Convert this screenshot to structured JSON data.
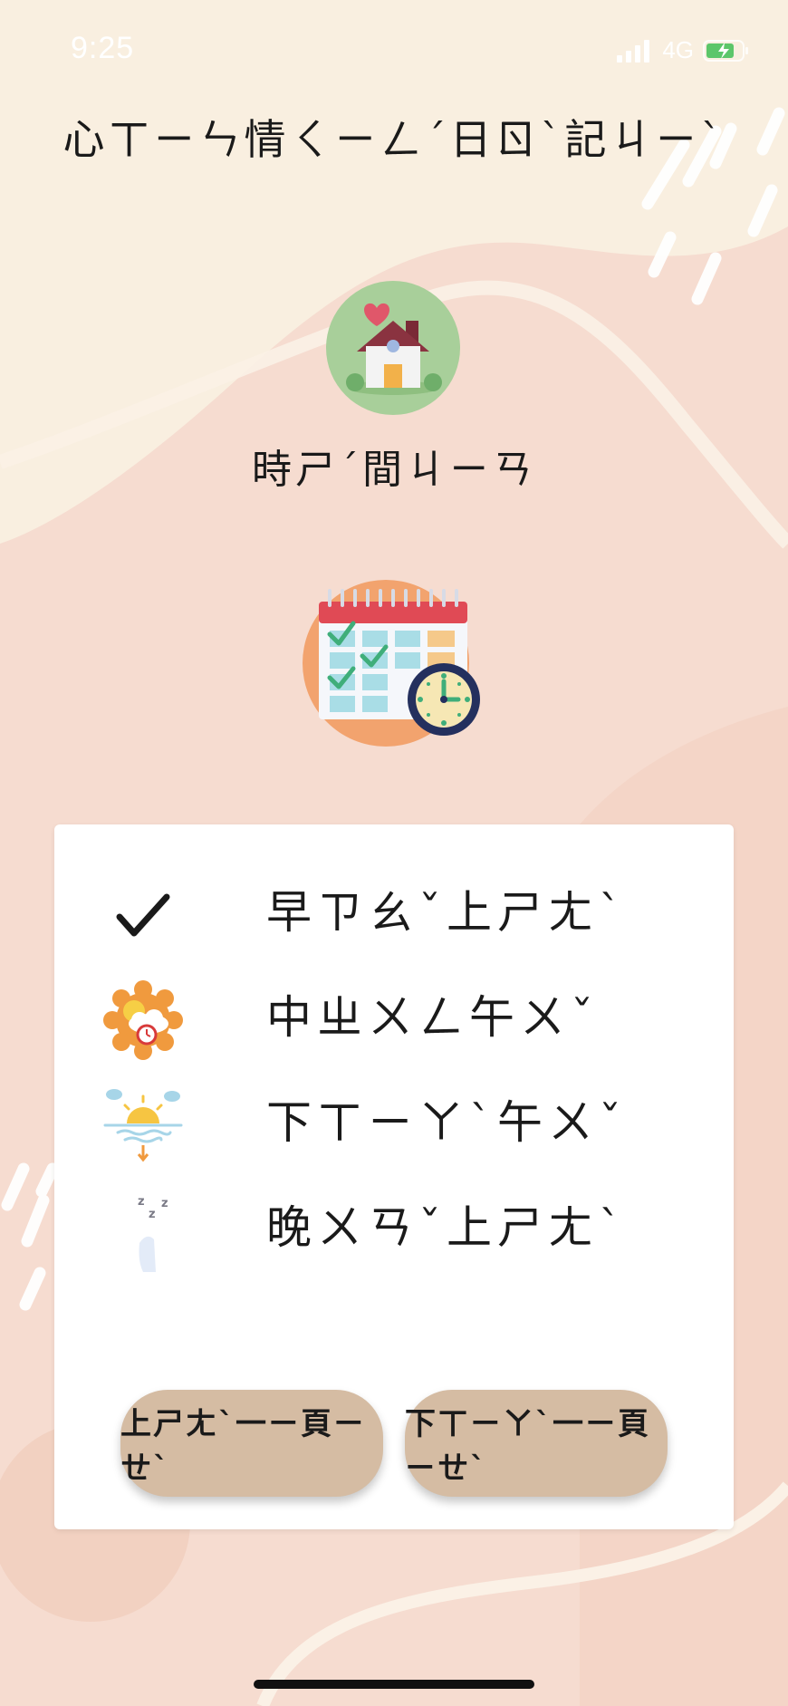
{
  "status_bar": {
    "time": "9:25",
    "network": "4G",
    "signal_icon": "signal-icon",
    "battery_icon": "battery-charging-icon"
  },
  "header": {
    "title": "心ㄒㄧㄣ情ㄑㄧㄥˊ日ㄖˋ記ㄐㄧˋ"
  },
  "category": {
    "icon": "house-heart-icon",
    "label": "時ㄕˊ間ㄐㄧㄢ"
  },
  "illustration": {
    "icon": "calendar-clock-icon"
  },
  "options": [
    {
      "label": "早ㄗㄠˇ上ㄕㄤˋ",
      "icon": "checkmark-icon",
      "selected": true
    },
    {
      "label": "中ㄓㄨㄥ午ㄨˇ",
      "icon": "sun-cloud-clock-icon",
      "selected": false
    },
    {
      "label": "下ㄒㄧㄚˋ午ㄨˇ",
      "icon": "sunset-icon",
      "selected": false
    },
    {
      "label": "晚ㄨㄢˇ上ㄕㄤˋ",
      "icon": "moon-sleep-icon",
      "selected": false
    }
  ],
  "navigation": {
    "prev_label": "上ㄕㄤˋ一ㄧ頁ㄧㄝˋ",
    "next_label": "下ㄒㄧㄚˋ一ㄧ頁ㄧㄝˋ"
  },
  "colors": {
    "background": "#f6dcd0",
    "top_band": "#f9efe0",
    "card": "#ffffff",
    "button": "#d5bca3",
    "icon_circle_green": "#a8cf9a",
    "illustration_circle": "#f2a36e"
  }
}
